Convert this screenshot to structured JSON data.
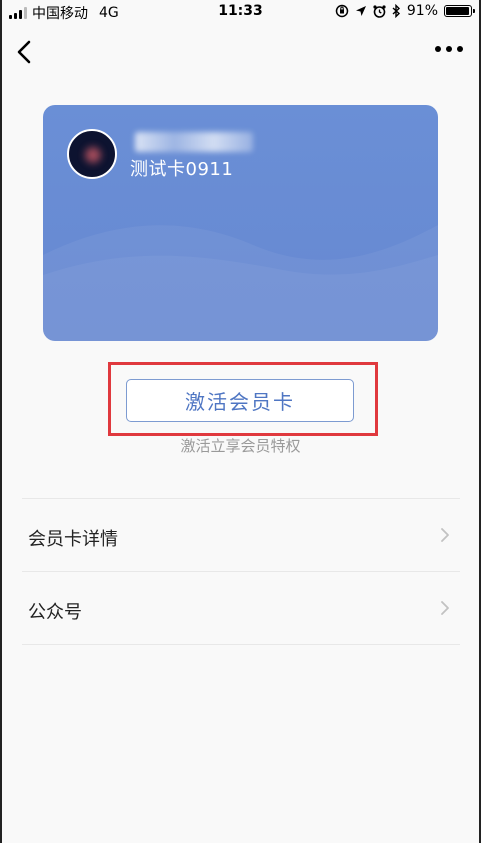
{
  "status_bar": {
    "carrier": "中国移动",
    "network": "4G",
    "time": "11:33",
    "battery_percent": "91%"
  },
  "nav": {
    "back_icon": "chevron-left-icon",
    "more_icon": "more-dots-icon"
  },
  "card": {
    "name": "测试卡0911",
    "bg_color": "#6a8fd6"
  },
  "activate": {
    "button_label": "激活会员卡",
    "subtitle": "激活立享会员特权",
    "highlight_color": "#e0393e"
  },
  "list": {
    "items": [
      {
        "label": "会员卡详情"
      },
      {
        "label": "公众号"
      }
    ]
  }
}
